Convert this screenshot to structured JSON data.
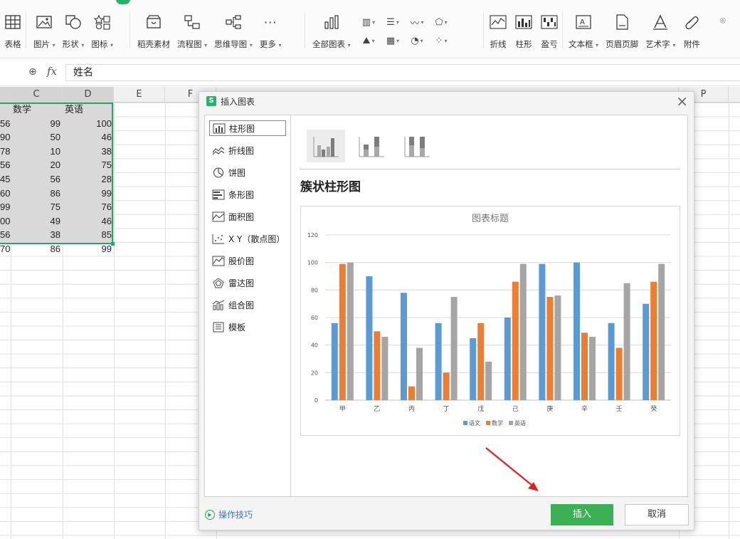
{
  "ribbon": {
    "items": [
      {
        "label": "表格",
        "icon": "table-icon"
      },
      {
        "label": "图片",
        "icon": "picture-icon",
        "dropdown": true
      },
      {
        "label": "形状",
        "icon": "shape-icon",
        "dropdown": true
      },
      {
        "label": "图标",
        "icon": "icon-library-icon",
        "dropdown": true
      },
      {
        "label": "稻壳素材",
        "icon": "material-icon"
      },
      {
        "label": "流程图",
        "icon": "flowchart-icon",
        "dropdown": true
      },
      {
        "label": "思维导图",
        "icon": "mindmap-icon",
        "dropdown": true
      },
      {
        "label": "更多",
        "icon": "more-icon",
        "dropdown": true
      },
      {
        "label": "全部图表",
        "icon": "all-charts-icon",
        "dropdown": true
      },
      {
        "label": "折线",
        "icon": "sparkline-line-icon"
      },
      {
        "label": "柱形",
        "icon": "sparkline-column-icon"
      },
      {
        "label": "盈亏",
        "icon": "sparkline-winloss-icon"
      },
      {
        "label": "文本框",
        "icon": "textbox-icon",
        "dropdown": true
      },
      {
        "label": "页眉页脚",
        "icon": "header-footer-icon"
      },
      {
        "label": "艺术字",
        "icon": "wordart-icon",
        "dropdown": true
      },
      {
        "label": "附件",
        "icon": "attachment-icon"
      }
    ]
  },
  "formula_bar": {
    "value": "姓名"
  },
  "sheet": {
    "columns": [
      "C",
      "D",
      "E",
      "F",
      "P"
    ],
    "headers": {
      "c": "数学",
      "d": "英语"
    },
    "rows": [
      {
        "b": "56",
        "c": "99",
        "d": "100"
      },
      {
        "b": "90",
        "c": "50",
        "d": "46"
      },
      {
        "b": "78",
        "c": "10",
        "d": "38"
      },
      {
        "b": "56",
        "c": "20",
        "d": "75"
      },
      {
        "b": "45",
        "c": "56",
        "d": "28"
      },
      {
        "b": "60",
        "c": "86",
        "d": "99"
      },
      {
        "b": "99",
        "c": "75",
        "d": "76"
      },
      {
        "b": "00",
        "c": "49",
        "d": "46"
      },
      {
        "b": "56",
        "c": "38",
        "d": "85"
      },
      {
        "b": "70",
        "c": "86",
        "d": "99"
      }
    ]
  },
  "dialog": {
    "title": "插入图表",
    "close_glyph": "×",
    "chart_types": [
      {
        "label": "柱形图",
        "icon": "column-chart-icon",
        "active": true
      },
      {
        "label": "折线图",
        "icon": "line-chart-icon"
      },
      {
        "label": "饼图",
        "icon": "pie-chart-icon"
      },
      {
        "label": "条形图",
        "icon": "bar-chart-icon"
      },
      {
        "label": "面积图",
        "icon": "area-chart-icon"
      },
      {
        "label": "X Y（散点图）",
        "icon": "scatter-chart-icon"
      },
      {
        "label": "股价图",
        "icon": "stock-chart-icon"
      },
      {
        "label": "雷达图",
        "icon": "radar-chart-icon"
      },
      {
        "label": "组合图",
        "icon": "combo-chart-icon"
      },
      {
        "label": "模板",
        "icon": "template-icon"
      }
    ],
    "subtype_name": "簇状柱形图",
    "tips": "操作技巧",
    "insert": "插入",
    "cancel": "取消"
  },
  "chart_data": {
    "type": "bar",
    "title": "图表标题",
    "categories": [
      "甲",
      "乙",
      "丙",
      "丁",
      "戊",
      "己",
      "庚",
      "辛",
      "壬",
      "癸"
    ],
    "series": [
      {
        "name": "语文",
        "color": "#5b9bd5",
        "values": [
          56,
          90,
          78,
          56,
          45,
          60,
          99,
          100,
          56,
          70
        ]
      },
      {
        "name": "数学",
        "color": "#ed7d31",
        "values": [
          99,
          50,
          10,
          20,
          56,
          86,
          75,
          49,
          38,
          86
        ]
      },
      {
        "name": "英语",
        "color": "#a5a5a5",
        "values": [
          100,
          46,
          38,
          75,
          28,
          99,
          76,
          46,
          85,
          99
        ]
      }
    ],
    "ylim": [
      0,
      120
    ],
    "yticks": [
      0,
      20,
      40,
      60,
      80,
      100,
      120
    ],
    "grid": true,
    "legend": "bottom"
  }
}
